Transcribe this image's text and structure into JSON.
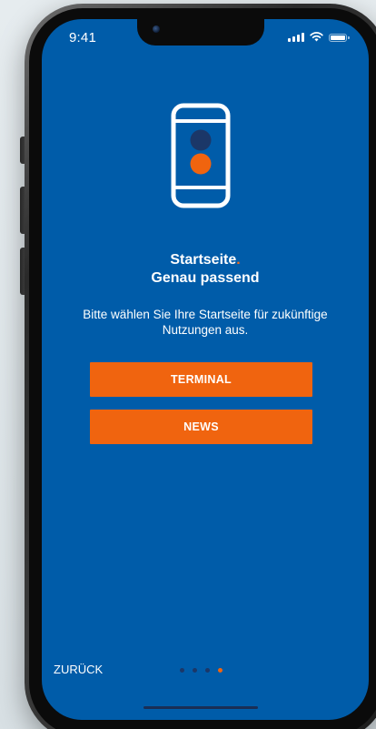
{
  "status_bar": {
    "time": "9:41",
    "icons": [
      "cellular-signal-icon",
      "wifi-icon",
      "battery-icon"
    ]
  },
  "illustration": {
    "icon": "phone-traffic-light-icon",
    "colors": {
      "top_dot": "#1b3768",
      "bottom_dot": "#f0640f",
      "outline": "#ffffff"
    }
  },
  "headline": {
    "line1": "Startseite",
    "accent_dot": ".",
    "line2": "Genau passend"
  },
  "subtitle": "Bitte wählen Sie Ihre Startseite für zukünftige Nutzungen aus.",
  "options": [
    {
      "label": "TERMINAL"
    },
    {
      "label": "NEWS"
    }
  ],
  "footer": {
    "back_label": "ZURÜCK",
    "pager": {
      "total": 4,
      "active_index": 3
    }
  },
  "colors": {
    "background": "#005ca9",
    "accent": "#f0640f",
    "dark_dot": "#1b3768"
  }
}
